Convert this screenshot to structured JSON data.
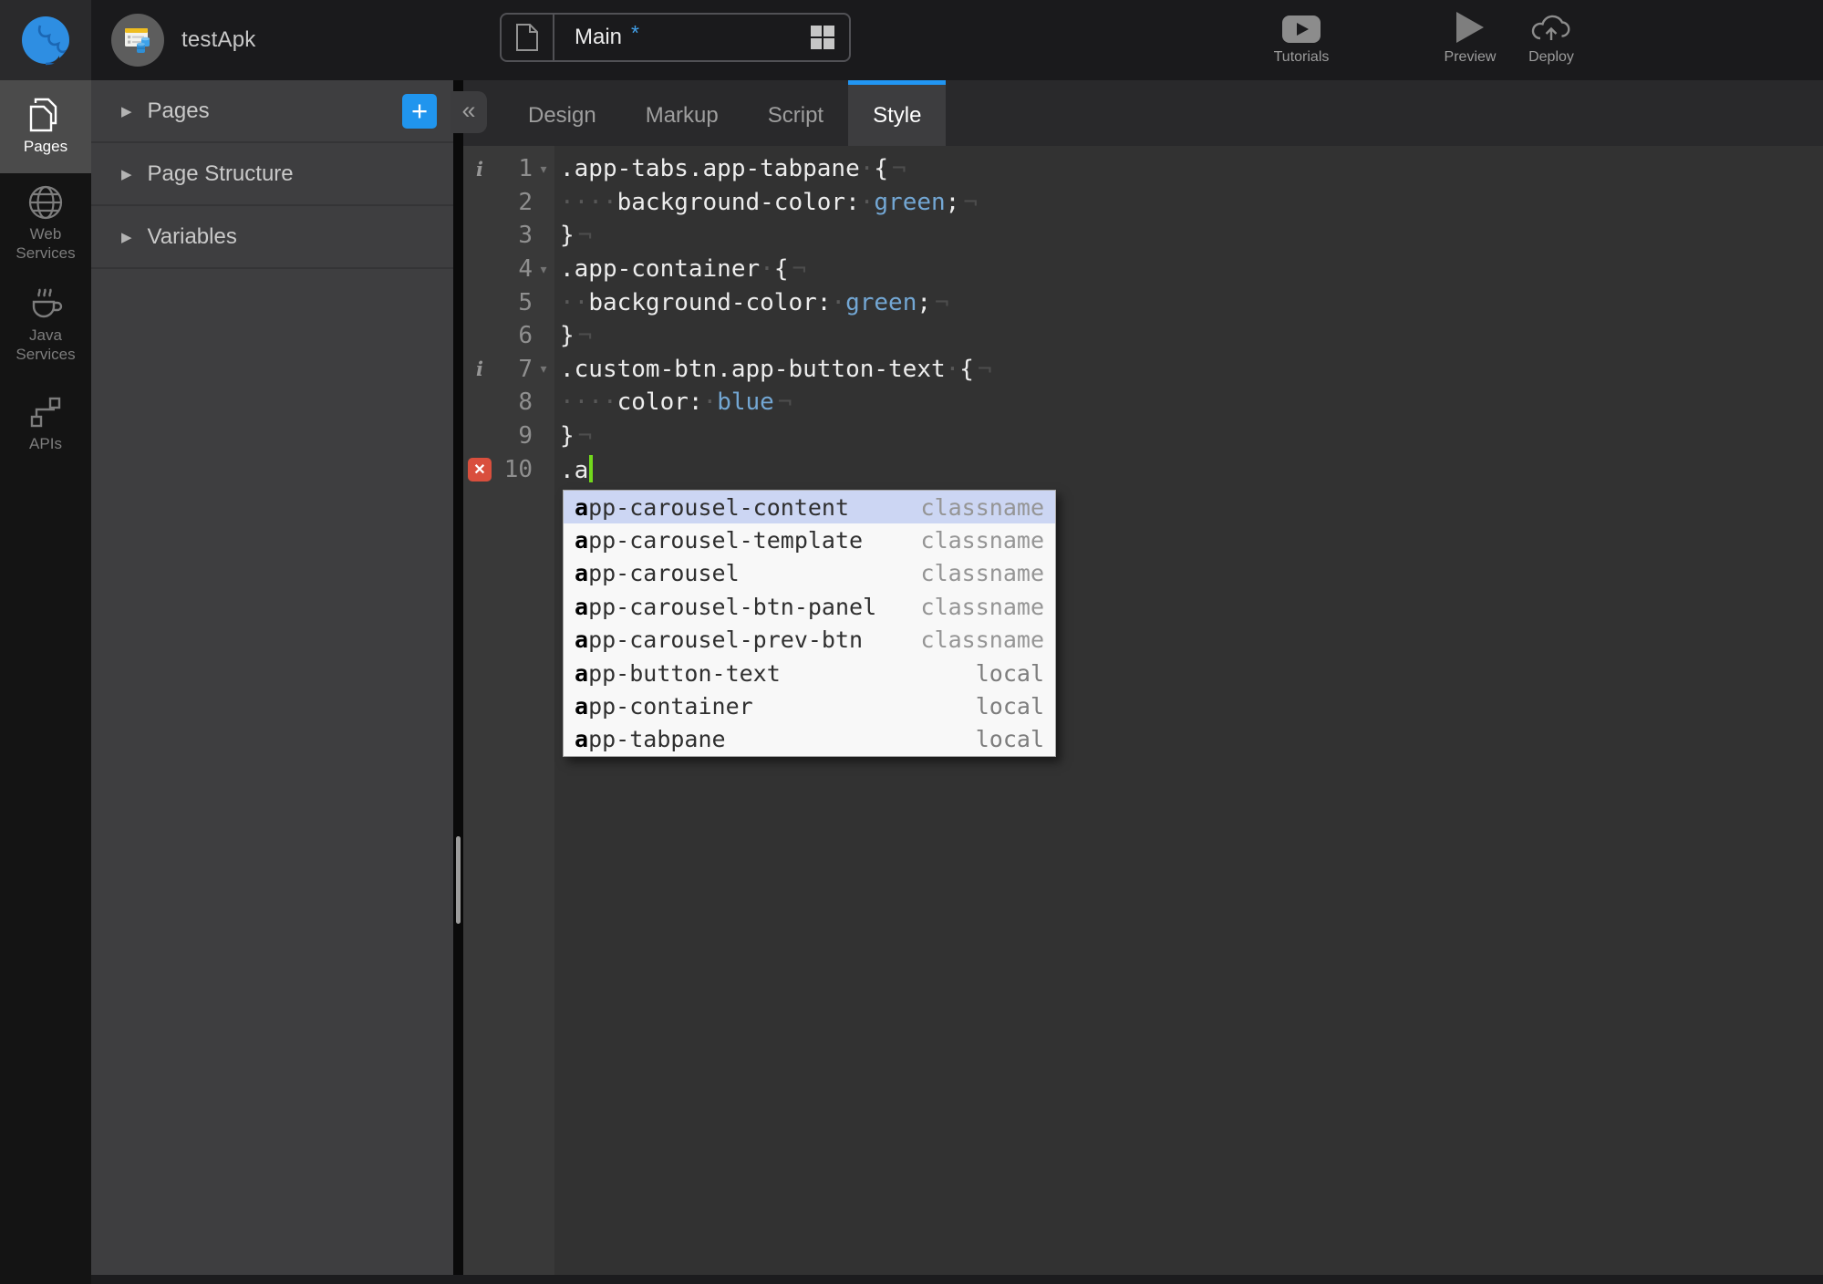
{
  "app": {
    "title": "testApk"
  },
  "colors": {
    "accent_blue": "#2196f3",
    "logo_blue": "#2e8ee2",
    "editor_value_blue": "#73a7d4",
    "cursor_green": "#72d81c",
    "error_red": "#d94f3d",
    "selected_suggestion": "#ccd6f3"
  },
  "topbar": {
    "page_tab": {
      "label": "Main",
      "dirty_marker": "*"
    },
    "actions": [
      {
        "label": "Tutorials",
        "icon": "youtube-icon"
      },
      {
        "label": "Preview",
        "icon": "play-icon"
      },
      {
        "label": "Deploy",
        "icon": "cloud-upload-icon"
      }
    ]
  },
  "nav_rail": {
    "items": [
      {
        "label": "Pages",
        "icon": "pages-icon",
        "active": true
      },
      {
        "label": "Web Services",
        "icon": "globe-icon",
        "active": false
      },
      {
        "label": "Java Services",
        "icon": "coffee-icon",
        "active": false
      },
      {
        "label": "APIs",
        "icon": "api-nodes-icon",
        "active": false
      }
    ]
  },
  "panel": {
    "collapse_glyph": "«",
    "sections": [
      {
        "label": "Pages",
        "arrow": "▶",
        "add_button": "+"
      },
      {
        "label": "Page Structure",
        "arrow": "▶"
      },
      {
        "label": "Variables",
        "arrow": "▶"
      }
    ]
  },
  "editor": {
    "tabs": [
      {
        "label": "Design",
        "active": false
      },
      {
        "label": "Markup",
        "active": false
      },
      {
        "label": "Script",
        "active": false
      },
      {
        "label": "Style",
        "active": true
      }
    ],
    "fold_glyph": "▾",
    "info_glyph": "i",
    "error_glyph": "✕",
    "lines": [
      {
        "num": "1",
        "marker": "info",
        "fold": true,
        "tokens": [
          {
            "k": "code",
            "text": ".app-tabs.app-tabpane"
          },
          {
            "k": "ws",
            "text": " "
          },
          {
            "k": "code",
            "text": "{"
          },
          {
            "k": "eol",
            "text": "¬"
          }
        ]
      },
      {
        "num": "2",
        "marker": "",
        "fold": false,
        "tokens": [
          {
            "k": "ws",
            "text": "    "
          },
          {
            "k": "code",
            "text": "background-color:"
          },
          {
            "k": "ws",
            "text": " "
          },
          {
            "k": "val",
            "text": "green"
          },
          {
            "k": "code",
            "text": ";"
          },
          {
            "k": "eol",
            "text": "¬"
          }
        ]
      },
      {
        "num": "3",
        "marker": "",
        "fold": false,
        "tokens": [
          {
            "k": "code",
            "text": "}"
          },
          {
            "k": "eol",
            "text": "¬"
          }
        ]
      },
      {
        "num": "4",
        "marker": "",
        "fold": true,
        "tokens": [
          {
            "k": "code",
            "text": ".app-container"
          },
          {
            "k": "ws",
            "text": " "
          },
          {
            "k": "code",
            "text": "{"
          },
          {
            "k": "eol",
            "text": "¬"
          }
        ]
      },
      {
        "num": "5",
        "marker": "",
        "fold": false,
        "tokens": [
          {
            "k": "ws",
            "text": "  "
          },
          {
            "k": "code",
            "text": "background-color:"
          },
          {
            "k": "ws",
            "text": " "
          },
          {
            "k": "val",
            "text": "green"
          },
          {
            "k": "code",
            "text": ";"
          },
          {
            "k": "eol",
            "text": "¬"
          }
        ]
      },
      {
        "num": "6",
        "marker": "",
        "fold": false,
        "tokens": [
          {
            "k": "code",
            "text": "}"
          },
          {
            "k": "eol",
            "text": "¬"
          }
        ]
      },
      {
        "num": "7",
        "marker": "info",
        "fold": true,
        "tokens": [
          {
            "k": "code",
            "text": ".custom-btn.app-button-text"
          },
          {
            "k": "ws",
            "text": " "
          },
          {
            "k": "code",
            "text": "{"
          },
          {
            "k": "eol",
            "text": "¬"
          }
        ]
      },
      {
        "num": "8",
        "marker": "",
        "fold": false,
        "tokens": [
          {
            "k": "ws",
            "text": "    "
          },
          {
            "k": "code",
            "text": "color:"
          },
          {
            "k": "ws",
            "text": " "
          },
          {
            "k": "val",
            "text": "blue"
          },
          {
            "k": "eol",
            "text": "¬"
          }
        ]
      },
      {
        "num": "9",
        "marker": "",
        "fold": false,
        "tokens": [
          {
            "k": "code",
            "text": "}"
          },
          {
            "k": "eol",
            "text": "¬"
          }
        ]
      },
      {
        "num": "10",
        "marker": "error",
        "fold": false,
        "tokens": [
          {
            "k": "code",
            "text": ".a"
          },
          {
            "k": "cursor",
            "text": ""
          }
        ]
      }
    ],
    "autocomplete": {
      "matched_prefix": "a",
      "items": [
        {
          "name": "app-carousel-content",
          "type": "classname",
          "selected": true
        },
        {
          "name": "app-carousel-template",
          "type": "classname",
          "selected": false
        },
        {
          "name": "app-carousel",
          "type": "classname",
          "selected": false
        },
        {
          "name": "app-carousel-btn-panel",
          "type": "classname",
          "selected": false
        },
        {
          "name": "app-carousel-prev-btn",
          "type": "classname",
          "selected": false
        },
        {
          "name": "app-button-text",
          "type": "local",
          "selected": false
        },
        {
          "name": "app-container",
          "type": "local",
          "selected": false
        },
        {
          "name": "app-tabpane",
          "type": "local",
          "selected": false
        }
      ]
    }
  }
}
